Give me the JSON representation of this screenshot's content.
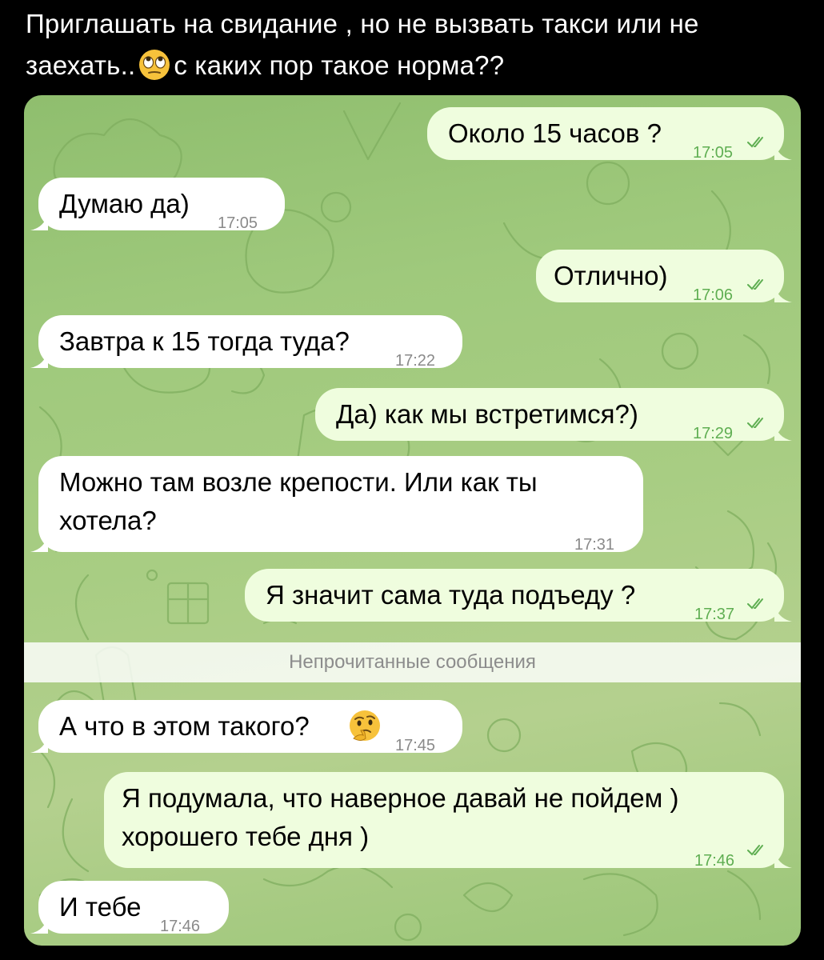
{
  "post": {
    "caption_line1": "Приглашать на свидание , но не вызвать такси или не",
    "caption_line2a": "заехать..",
    "caption_line2b": "с каких пор такое норма??",
    "caption_emoji": "eye-roll-emoji"
  },
  "chat": {
    "unread_divider": "Непрочитанные сообщения",
    "messages": [
      {
        "direction": "outgoing",
        "text": "Около 15 часов ?",
        "time": "17:05",
        "read": true
      },
      {
        "direction": "incoming",
        "text": "Думаю да)",
        "time": "17:05"
      },
      {
        "direction": "outgoing",
        "text": "Отлично)",
        "time": "17:06",
        "read": true
      },
      {
        "direction": "incoming",
        "text": "Завтра к 15 тогда туда?",
        "time": "17:22"
      },
      {
        "direction": "outgoing",
        "text": "Да) как мы встретимся?)",
        "time": "17:29",
        "read": true
      },
      {
        "direction": "incoming",
        "text_line1": "Можно там возле крепости. Или как ты",
        "text_line2": "хотела?",
        "time": "17:31"
      },
      {
        "direction": "outgoing",
        "text": "Я значит сама туда подъеду ?",
        "time": "17:37",
        "read": true
      },
      {
        "direction": "incoming",
        "text": "А что в этом такого?",
        "emoji": "thinking-face-emoji",
        "time": "17:45"
      },
      {
        "direction": "outgoing",
        "text_line1": "Я подумала, что наверное давай не пойдем )",
        "text_line2": "хорошего тебе дня )",
        "time": "17:46",
        "read": true
      },
      {
        "direction": "incoming",
        "text": "И тебе",
        "time": "17:46"
      }
    ]
  },
  "colors": {
    "page_background": "#000000",
    "chat_background": "#a3ca7f",
    "incoming_bubble": "#ffffff",
    "outgoing_bubble": "#effdde",
    "outgoing_time": "#5fae52",
    "incoming_time": "#8a8a8a"
  }
}
